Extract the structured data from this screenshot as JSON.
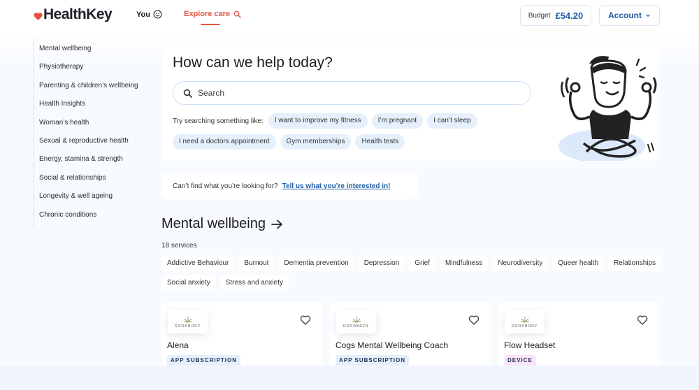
{
  "header": {
    "brand": "HealthKey",
    "nav": {
      "you_label": "You",
      "explore_label": "Explore care"
    },
    "budget": {
      "label": "Budget",
      "value": "£54.20"
    },
    "account_label": "Account"
  },
  "sidebar": {
    "items": [
      {
        "label": "Mental wellbeing"
      },
      {
        "label": "Physiotherapy"
      },
      {
        "label": "Parenting & children’s wellbeing"
      },
      {
        "label": "Health Insights"
      },
      {
        "label": "Woman’s health"
      },
      {
        "label": "Sexual & reproductive health"
      },
      {
        "label": "Energy, stamina & strength"
      },
      {
        "label": "Social & relationships"
      },
      {
        "label": "Longevity & well ageing"
      },
      {
        "label": "Chronic conditions"
      }
    ]
  },
  "hero": {
    "title": "How can we help today?",
    "search": {
      "placeholder": "Search",
      "value": ""
    },
    "suggest_label": "Try searching something like:",
    "suggestions": [
      "I want to improve my fitness",
      "I’m pregnant",
      "I can’t sleep",
      "I need a doctors appointment",
      "Gym memberships",
      "Health tests"
    ]
  },
  "feedback": {
    "text": "Can’t find what you’re looking for?",
    "link": "Tell us what you’re interested in!"
  },
  "section": {
    "title": "Mental wellbeing",
    "count": "18 services",
    "tags": [
      "Addictive Behaviour",
      "Burnout",
      "Dementia prevention",
      "Depression",
      "Grief",
      "Mindfulness",
      "Neurodiversity",
      "Queer health",
      "Relationships",
      "Social anxiety",
      "Stress and anxiety"
    ],
    "cards": [
      {
        "provider": "GOODBODY",
        "title": "Alena",
        "badge": "APP SUBSCRIPTION",
        "badge_type": "app"
      },
      {
        "provider": "GOODBODY",
        "title": "Cogs Mental Wellbeing Coach",
        "badge": "APP SUBSCRIPTION",
        "badge_type": "app"
      },
      {
        "provider": "GOODBODY",
        "title": "Flow Headset",
        "badge": "DEVICE",
        "badge_type": "device"
      }
    ]
  },
  "colors": {
    "accent": "#e5533f",
    "primary": "#1d5aa6",
    "chip_bg": "#e6f0fc",
    "device_badge_bg": "#fbe6f7"
  }
}
